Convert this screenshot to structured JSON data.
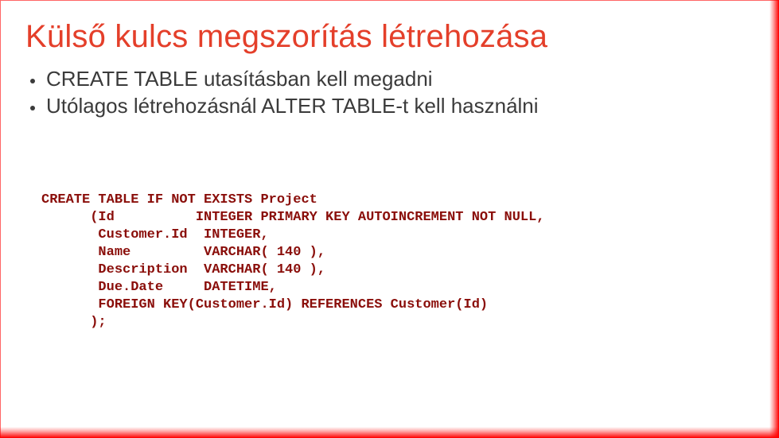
{
  "slide": {
    "title": "Külső kulcs megszorítás létrehozása",
    "bullets": [
      "CREATE TABLE utasításban kell megadni",
      "Utólagos létrehozásnál ALTER TABLE-t kell használni"
    ],
    "code": "CREATE TABLE IF NOT EXISTS Project\n      (Id          INTEGER PRIMARY KEY AUTOINCREMENT NOT NULL,\n       Customer.Id  INTEGER,\n       Name         VARCHAR( 140 ),\n       Description  VARCHAR( 140 ),\n       Due.Date     DATETIME,\n       FOREIGN KEY(Customer.Id) REFERENCES Customer(Id)\n      );"
  },
  "colors": {
    "accent": "#e43f2a",
    "code": "#8a0e0a",
    "text": "#3b3b3b"
  }
}
